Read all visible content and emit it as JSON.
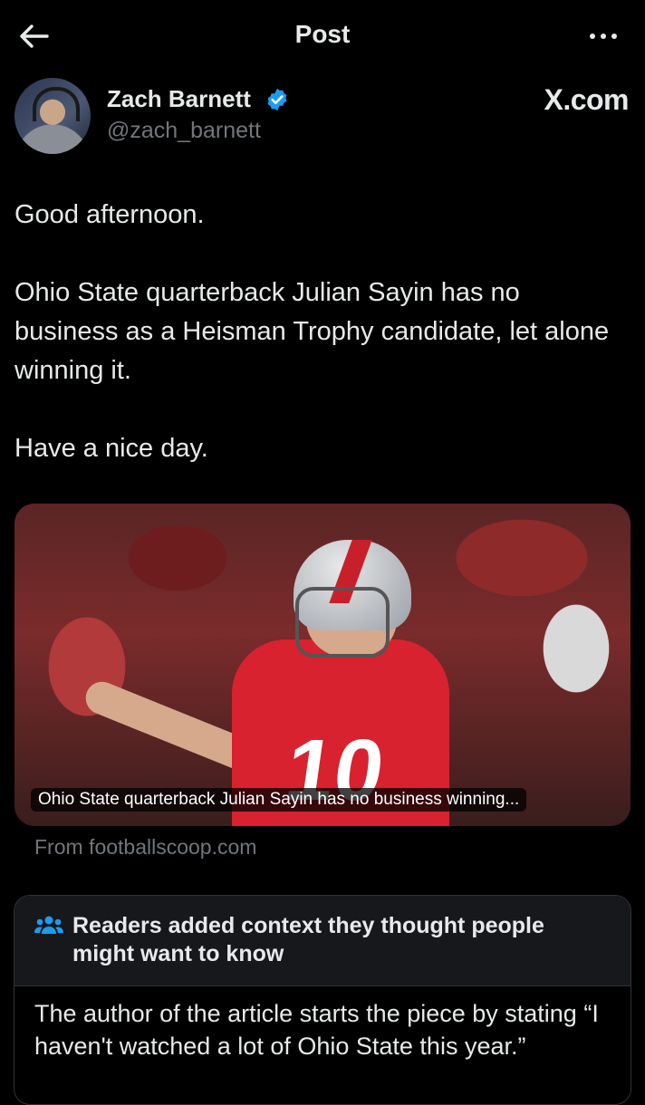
{
  "header": {
    "title": "Post",
    "back_icon": "arrow-left-icon",
    "more_icon": "more-horizontal-icon"
  },
  "author": {
    "name": "Zach Barnett",
    "handle": "@zach_barnett",
    "verified": true,
    "verified_color": "#1d9bf0"
  },
  "source_logo": "X.com",
  "post": {
    "text": "Good afternoon.\n\nOhio State quarterback Julian Sayin has no business as a Heisman Trophy candidate, let alone winning it.\n\nHave a nice day."
  },
  "media": {
    "caption": "Ohio State quarterback Julian Sayin has no business winning...",
    "jersey_number": "10",
    "source": "From footballscoop.com"
  },
  "community_note": {
    "icon": "people-icon",
    "icon_color": "#1d9bf0",
    "title": "Readers added context they thought people might want to know",
    "body": "The author of the article starts the piece by stating “I haven't watched a lot of Ohio State this year.”"
  }
}
